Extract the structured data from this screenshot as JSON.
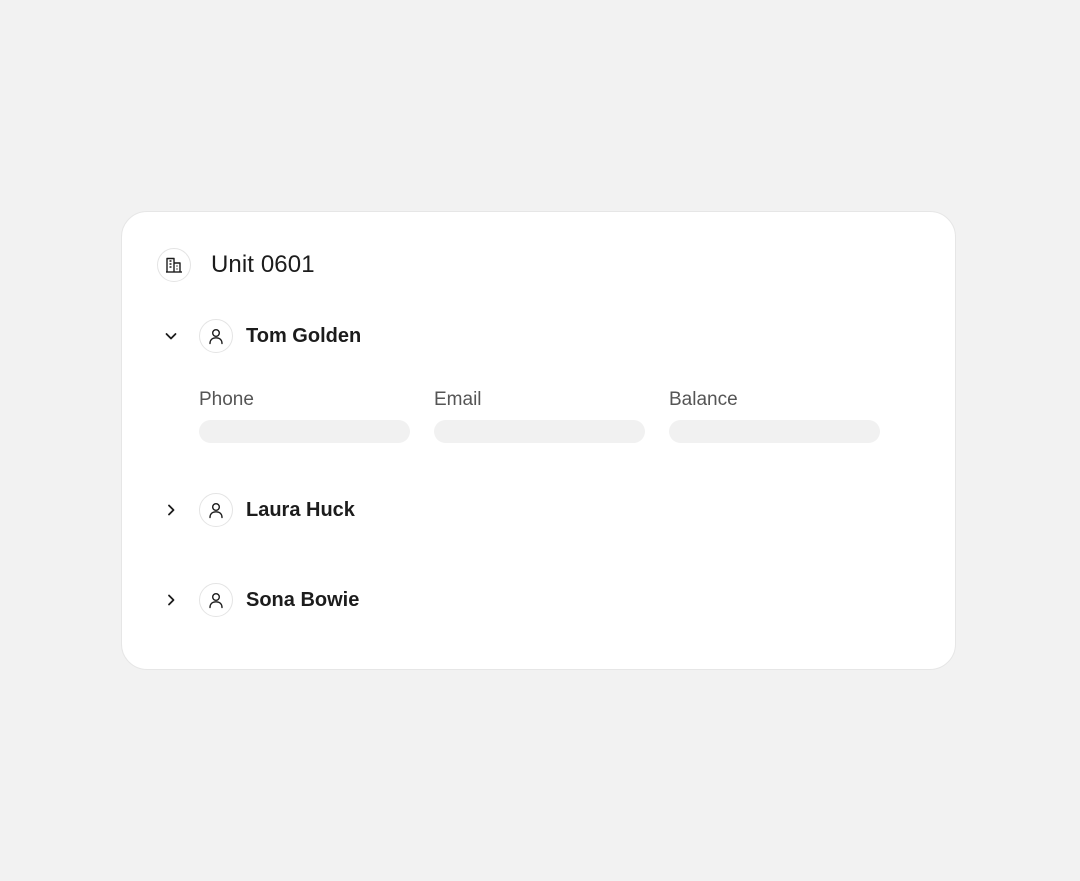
{
  "unit": {
    "title": "Unit 0601",
    "icon": "building-icon"
  },
  "people": [
    {
      "name": "Tom Golden",
      "expanded": true,
      "icon": "person-icon",
      "details": {
        "phone_label": "Phone",
        "email_label": "Email",
        "balance_label": "Balance"
      }
    },
    {
      "name": "Laura Huck",
      "expanded": false,
      "icon": "person-icon"
    },
    {
      "name": "Sona Bowie",
      "expanded": false,
      "icon": "person-icon"
    }
  ],
  "colors": {
    "background": "#f2f2f2",
    "card": "#ffffff",
    "skeleton": "#f1f1f1",
    "text": "#1c1c1c",
    "label": "#555555"
  }
}
